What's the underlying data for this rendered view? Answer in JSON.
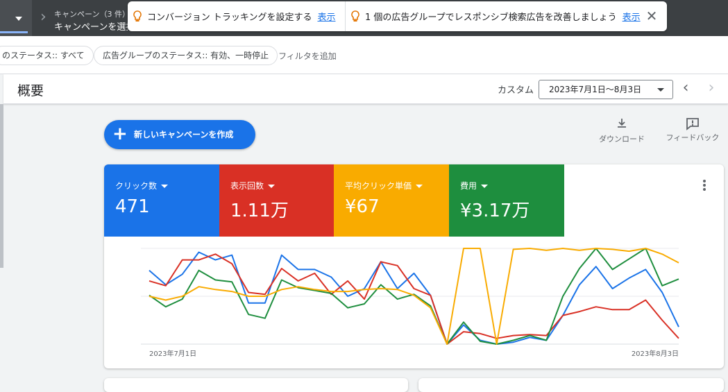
{
  "topbar": {
    "campaign_sub": "キャンペーン（3 件）",
    "campaign_main": "キャンペーンを選択"
  },
  "notices": {
    "tip1": "コンバージョン トラッキングを設定する",
    "tip1_link": "表示",
    "tip2": "1 個の広告グループでレスポンシブ検索広告を改善しましょう",
    "tip2_link": "表示"
  },
  "filters": {
    "chip1": "のステータス:: すべて",
    "chip2": "広告グループのステータス:: 有効、一時停止",
    "add": "フィルタを追加"
  },
  "header": {
    "title": "概要",
    "custom": "カスタム",
    "date_range": "2023年7月1日〜8月3日"
  },
  "actions": {
    "new_campaign": "新しいキャンペーンを作成",
    "download": "ダウンロード",
    "feedback": "フィードバック"
  },
  "metrics": [
    {
      "label": "クリック数",
      "value": "471",
      "color": "#1a73e8"
    },
    {
      "label": "表示回数",
      "value": "1.11万",
      "color": "#d93025"
    },
    {
      "label": "平均クリック単価",
      "value": "¥67",
      "color": "#f9ab00"
    },
    {
      "label": "費用",
      "value": "¥3.17万",
      "color": "#1e8e3e"
    }
  ],
  "chart_data": {
    "type": "line",
    "x_start_label": "2023年7月1日",
    "x_end_label": "2023年8月3日",
    "grid": true,
    "series": [
      {
        "color": "#1a73e8",
        "values": [
          0.77,
          0.62,
          0.73,
          0.96,
          0.88,
          0.93,
          0.43,
          0.43,
          0.93,
          0.78,
          0.78,
          0.7,
          0.5,
          0.58,
          0.86,
          0.58,
          0.74,
          0.51,
          0.0,
          0.2,
          0.04,
          0.0,
          0.02,
          0.07,
          0.04,
          0.3,
          0.62,
          0.81,
          0.58,
          0.69,
          0.78,
          0.54,
          0.18
        ]
      },
      {
        "color": "#d93025",
        "values": [
          0.66,
          0.61,
          0.88,
          0.88,
          0.94,
          0.84,
          0.54,
          0.52,
          0.79,
          0.66,
          0.74,
          0.52,
          0.66,
          0.47,
          0.86,
          0.82,
          0.58,
          0.51,
          0.0,
          0.13,
          0.11,
          0.06,
          0.09,
          0.1,
          0.09,
          0.3,
          0.34,
          0.39,
          0.36,
          0.36,
          0.46,
          0.25,
          0.06
        ]
      },
      {
        "color": "#1e8e3e",
        "values": [
          0.51,
          0.39,
          0.47,
          0.77,
          0.67,
          0.65,
          0.31,
          0.27,
          0.67,
          0.59,
          0.56,
          0.53,
          0.38,
          0.42,
          0.62,
          0.47,
          0.52,
          0.4,
          0.0,
          0.23,
          0.03,
          0.0,
          0.04,
          0.09,
          0.04,
          0.5,
          0.79,
          1.0,
          0.78,
          0.89,
          1.0,
          0.61,
          0.68
        ]
      },
      {
        "color": "#f9ab00",
        "values": [
          0.5,
          0.46,
          0.5,
          0.6,
          0.57,
          0.55,
          0.5,
          0.5,
          0.57,
          0.6,
          0.57,
          0.55,
          0.55,
          0.57,
          0.58,
          0.57,
          0.51,
          0.38,
          0.0,
          1.0,
          1.0,
          0.0,
          0.99,
          1.0,
          0.98,
          1.0,
          0.98,
          1.0,
          0.99,
          0.97,
          1.0,
          0.94,
          0.85
        ]
      }
    ]
  }
}
